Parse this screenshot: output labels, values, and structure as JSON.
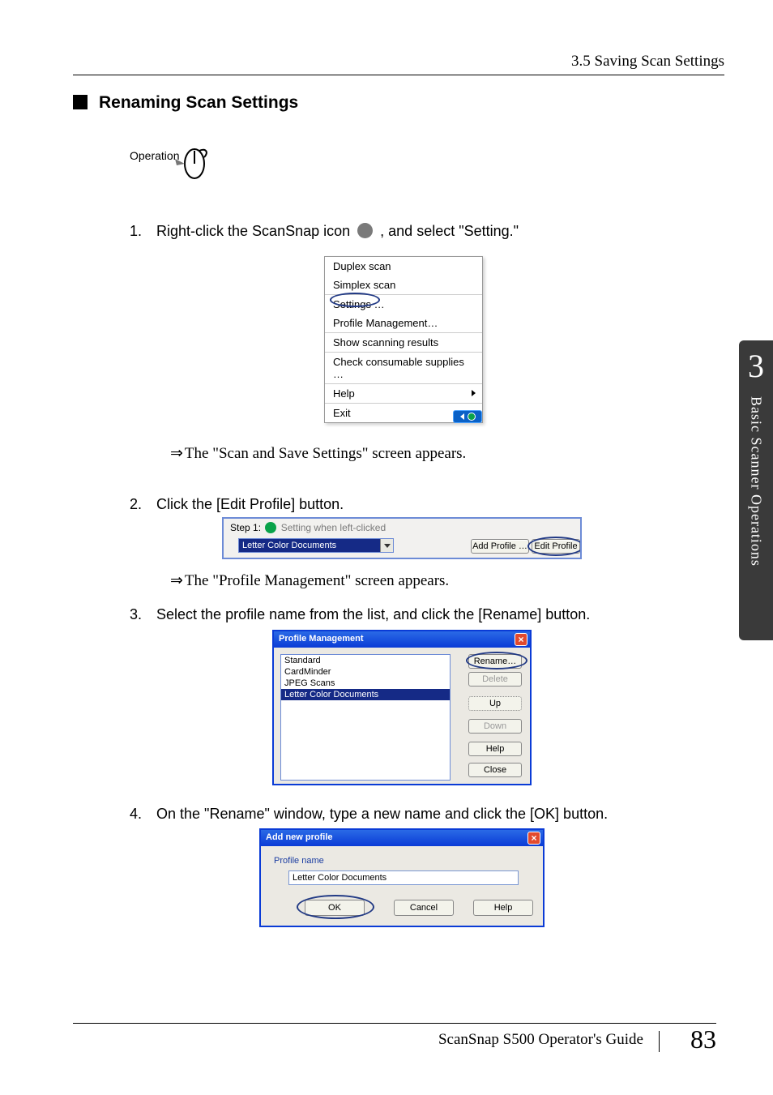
{
  "header": {
    "section_ref": "3.5 Saving Scan Settings"
  },
  "title": "Renaming Scan Settings",
  "operation_label": "Operation",
  "steps": {
    "s1_pre": "Right-click the ScanSnap icon ",
    "s1_post": " , and select \"Setting.\"",
    "s2": "Click the [Edit Profile] button.",
    "s3": "Select the profile name from the list, and click the [Rename] button.",
    "s4": "On the \"Rename\" window, type a new name and click the [OK] button."
  },
  "numbers": {
    "n1": "1.",
    "n2": "2.",
    "n3": "3.",
    "n4": "4."
  },
  "results": {
    "r1": "The \"Scan and Save Settings\" screen appears.",
    "r2": "The \"Profile Management\" screen appears."
  },
  "ctx_menu": {
    "items": [
      "Duplex scan",
      "Simplex scan",
      "Settings …",
      "Profile Management…",
      "Show scanning results",
      "Check consumable supplies …",
      "Help",
      "Exit"
    ]
  },
  "strip": {
    "step_label": "Step 1:",
    "step_desc": "Setting when left-clicked",
    "combo_value": "Letter Color Documents",
    "add_profile": "Add Profile …",
    "edit_profile": "Edit Profile …"
  },
  "pm": {
    "title": "Profile Management",
    "items": [
      "Standard",
      "CardMinder",
      "JPEG Scans",
      "Letter Color Documents"
    ],
    "buttons": {
      "rename": "Rename…",
      "delete": "Delete",
      "up": "Up",
      "down": "Down",
      "help": "Help",
      "close": "Close"
    }
  },
  "anp": {
    "title": "Add new profile",
    "label": "Profile name",
    "value": "Letter Color Documents",
    "ok": "OK",
    "cancel": "Cancel",
    "help": "Help"
  },
  "sidetab": {
    "chapter": "3",
    "text": "Basic Scanner Operations"
  },
  "footer": {
    "guide": "ScanSnap  S500 Operator's Guide",
    "page": "83"
  },
  "glyphs": {
    "arrow": "⇒",
    "x": "×"
  }
}
